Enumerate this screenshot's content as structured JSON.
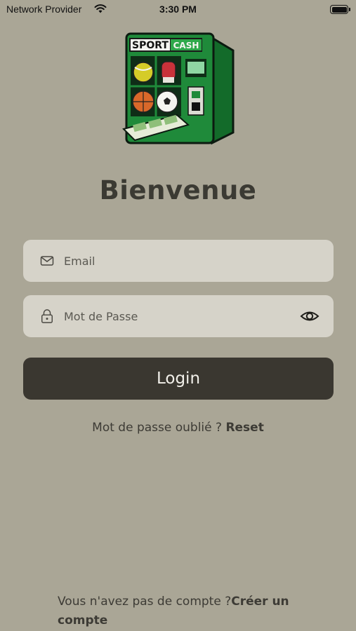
{
  "status_bar": {
    "carrier": "Network Provider",
    "time": "3:30 PM"
  },
  "logo": {
    "word_left": "SPORT",
    "word_right": "CASH"
  },
  "title": "Bienvenue",
  "form": {
    "email_placeholder": "Email",
    "password_placeholder": "Mot de Passe"
  },
  "login_label": "Login",
  "forgot": {
    "text": "Mot de passe oublié ? ",
    "link": "Reset"
  },
  "signup": {
    "text": "Vous n'avez pas de compte ?",
    "link": "Créer un compte"
  },
  "colors": {
    "background": "#aaa696",
    "input_bg": "#d6d3c9",
    "button_bg": "#3a3730",
    "logo_green": "#1f8a3a"
  },
  "icons": [
    "wifi-icon",
    "battery-icon",
    "mail-icon",
    "lock-icon",
    "eye-icon"
  ]
}
